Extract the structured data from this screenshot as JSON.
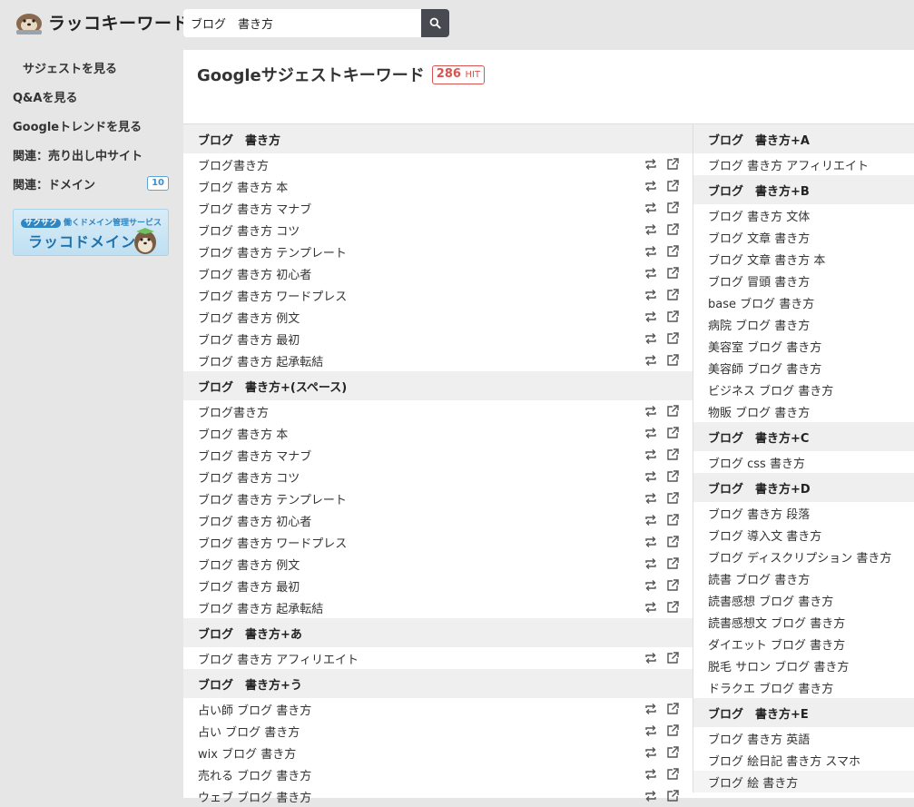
{
  "app": {
    "logo_text": "ラッコキーワード"
  },
  "search": {
    "value": "ブログ　書き方"
  },
  "sidebar": {
    "items": [
      {
        "label": "サジェストを見る"
      },
      {
        "label": "Q&Aを見る"
      },
      {
        "label": "Googleトレンドを見る"
      },
      {
        "label": "関連：売り出し中サイト"
      },
      {
        "label": "関連：ドメイン",
        "badge": "10"
      }
    ],
    "banner": {
      "sub_tag": "サクサク",
      "sub": "働くドメイン管理サービス",
      "main": "ラッコドメイン"
    }
  },
  "main": {
    "title": "Googleサジェストキーワード",
    "hit_count": "286",
    "hit_unit": "HIT"
  },
  "left_groups": [
    {
      "heading": "ブログ　書き方",
      "items": [
        "ブログ書き方",
        "ブログ 書き方 本",
        "ブログ 書き方 マナブ",
        "ブログ 書き方 コツ",
        "ブログ 書き方 テンプレート",
        "ブログ 書き方 初心者",
        "ブログ 書き方 ワードプレス",
        "ブログ 書き方 例文",
        "ブログ 書き方 最初",
        "ブログ 書き方 起承転結"
      ]
    },
    {
      "heading": "ブログ　書き方+(スペース)",
      "items": [
        "ブログ書き方",
        "ブログ 書き方 本",
        "ブログ 書き方 マナブ",
        "ブログ 書き方 コツ",
        "ブログ 書き方 テンプレート",
        "ブログ 書き方 初心者",
        "ブログ 書き方 ワードプレス",
        "ブログ 書き方 例文",
        "ブログ 書き方 最初",
        "ブログ 書き方 起承転結"
      ]
    },
    {
      "heading": "ブログ　書き方+あ",
      "items": [
        "ブログ 書き方 アフィリエイト"
      ]
    },
    {
      "heading": "ブログ　書き方+う",
      "items": [
        "占い師 ブログ 書き方",
        "占い ブログ 書き方",
        "wix ブログ 書き方",
        "売れる ブログ 書き方",
        "ウェブ ブログ 書き方"
      ]
    }
  ],
  "right_groups": [
    {
      "heading": "ブログ　書き方+A",
      "items": [
        "ブログ 書き方 アフィリエイト"
      ]
    },
    {
      "heading": "ブログ　書き方+B",
      "items": [
        "ブログ 書き方 文体",
        "ブログ 文章 書き方",
        "ブログ 文章 書き方 本",
        "ブログ 冒頭 書き方",
        "base ブログ 書き方",
        "病院 ブログ 書き方",
        "美容室 ブログ 書き方",
        "美容師 ブログ 書き方",
        "ビジネス ブログ 書き方",
        "物販 ブログ 書き方"
      ]
    },
    {
      "heading": "ブログ　書き方+C",
      "items": [
        "ブログ css 書き方"
      ]
    },
    {
      "heading": "ブログ　書き方+D",
      "items": [
        "ブログ 書き方 段落",
        "ブログ 導入文 書き方",
        "ブログ ディスクリプション 書き方",
        "読書 ブログ 書き方",
        "読書感想 ブログ 書き方",
        "読書感想文 ブログ 書き方",
        "ダイエット ブログ 書き方",
        "脱毛 サロン ブログ 書き方",
        "ドラクエ ブログ 書き方"
      ]
    },
    {
      "heading": "ブログ　書き方+E",
      "items": [
        "ブログ 書き方 英語",
        "ブログ 絵日記 書き方 スマホ",
        "ブログ 絵 書き方"
      ]
    }
  ]
}
